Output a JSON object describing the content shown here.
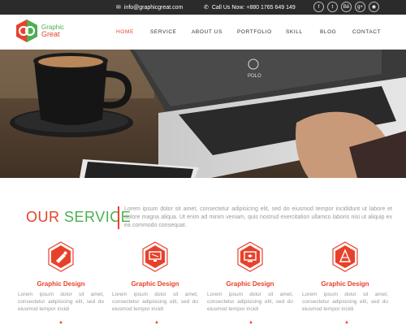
{
  "topbar": {
    "email": "info@graphicgreat.com",
    "phone": "Call Us Now: +880 1765 649 149",
    "socials": [
      "f",
      "t",
      "Bē",
      "g+",
      "◉"
    ]
  },
  "logo": {
    "line1": "Graphic",
    "line2": "Great"
  },
  "nav": {
    "items": [
      "HOME",
      "SERVICE",
      "ABOUT US",
      "PORTFOLIO",
      "SKILL",
      "BLOG",
      "CONTACT"
    ],
    "active": "HOME"
  },
  "hero": {
    "laptop_label": "POLO"
  },
  "service": {
    "title_part1": "OUR",
    "title_part2": "SERVICE",
    "description": "Lorem ipsum dolor sit amet, consectetur adipisicing elit, sed do eiusmod tempor incididunt ut labore et dolore magna aliqua. Ut enim ad minim veniam, quis nostrud exercitation ullamco laboris nisi ut aliquip ex ea commodo consequat.",
    "items": [
      {
        "title": "Graphic Design",
        "text": "Lorem ipsum dolor sit amet, consectetur adipisicing elit, sed do eiusmod tempor incidi",
        "icon": "brush-icon"
      },
      {
        "title": "Graphic Design",
        "text": "Lorem ipsum dolor sit amet, consectetur adipisicing elit, sed do eiusmod tempor incidi",
        "icon": "monitor-icon"
      },
      {
        "title": "Graphic Design",
        "text": "Lorem ipsum dolor sit amet, consectetur adipisicing elit, sed do eiusmod tempor incidi",
        "icon": "screen-icon"
      },
      {
        "title": "Graphic Design",
        "text": "Lorem ipsum dolor sit amet, consectetur adipisicing elit, sed do eiusmod tempor incidi",
        "icon": "pen-tool-icon"
      }
    ]
  },
  "colors": {
    "accent": "#e8412b",
    "green": "#4caf50",
    "topbar": "#2b2b2b"
  }
}
